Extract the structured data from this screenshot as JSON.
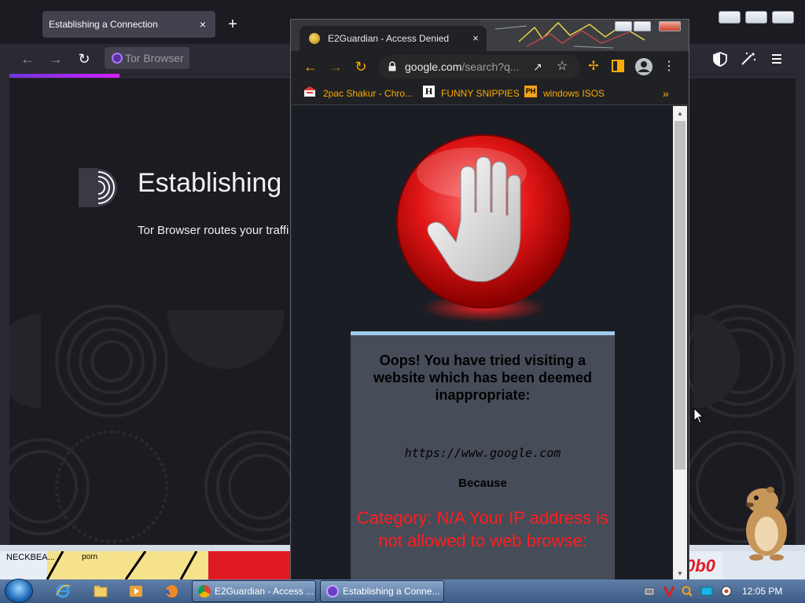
{
  "tor": {
    "tab_title": "Establishing a Connection",
    "tab_close": "×",
    "new_tab": "+",
    "url_text": "Tor Browser",
    "heading": "Establishing a",
    "description": "Tor Browser routes your traffi"
  },
  "chrome": {
    "tab_title": "E2Guardian - Access Denied",
    "tab_close": "×",
    "url_host": "google.com",
    "url_path": "/search?q...",
    "bookmarks": [
      {
        "label": "2pac Shakur - Chro..."
      },
      {
        "label": "FUNNY SNIPPIES",
        "icon_text": "H"
      },
      {
        "label": "windows ISOS",
        "icon_text": "PH"
      }
    ],
    "bookmarks_more": "»"
  },
  "block_page": {
    "headline": "Oops! You have tried visiting a website which has been deemed inappropriate:",
    "blocked_url": "https://www.google.com",
    "because_label": "Because",
    "reason": "Category: N/A  Your IP address is not allowed to web browse:"
  },
  "desktop": {
    "left_label": "NECKBEA...",
    "art_label": "porn",
    "right_label": "0b0"
  },
  "taskbar": {
    "buttons": [
      {
        "label": "E2Guardian - Access ..."
      },
      {
        "label": "Establishing a Conne..."
      }
    ],
    "clock": "12:05 PM"
  },
  "colors": {
    "chrome_accent": "#f9ab00",
    "block_reason": "#ff1e1e",
    "tor_progress": "#d41fff",
    "msg_box_border": "#9fcbeb"
  }
}
